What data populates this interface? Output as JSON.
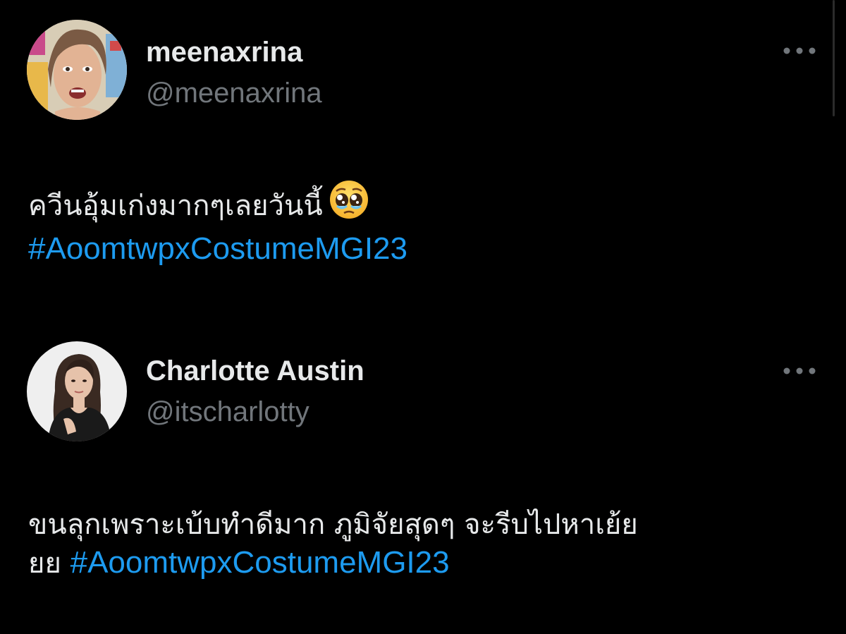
{
  "colors": {
    "background": "#000000",
    "text": "#e7e9ea",
    "secondary": "#71767b",
    "hashtag": "#1d9bf0"
  },
  "tweets": [
    {
      "display_name": "meenaxrina",
      "handle": "@meenaxrina",
      "avatar_icon": "avatar-photo-icon",
      "more_icon": "more-options-icon",
      "text_line1": "ควีนอุ้มเก่งมากๆเลยวันนี้",
      "emoji": "pleading-face-emoji-icon",
      "hashtag": "#AoomtwpxCostumeMGI23"
    },
    {
      "display_name": "Charlotte Austin",
      "handle": "@itscharlotty",
      "avatar_icon": "avatar-photo-icon",
      "more_icon": "more-options-icon",
      "text_line1": "ขนลุกเพราะเบ้บทำดีมาก ภูมิจัยสุดๆ จะรีบไปหาเย้ย",
      "text_line2": "ยย",
      "hashtag": "#AoomtwpxCostumeMGI23"
    }
  ]
}
